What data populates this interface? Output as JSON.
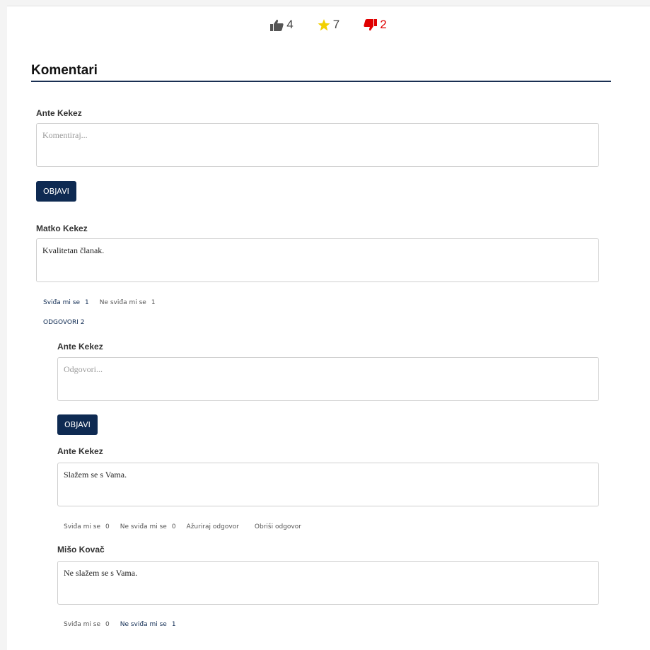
{
  "ratings": {
    "likes": "4",
    "stars": "7",
    "dislikes": "2",
    "colors": {
      "like": "#555555",
      "star": "#f2d000",
      "dislike": "#e00000"
    }
  },
  "section": {
    "title": "Komentari"
  },
  "new_comment": {
    "author": "Ante Kekez",
    "placeholder": "Komentiraj...",
    "submit_label": "OBJAVI"
  },
  "comments": [
    {
      "author": "Matko Kekez",
      "text": "Kvalitetan članak.",
      "like_label": "Sviđa mi se",
      "like_count": "1",
      "dislike_label": "Ne sviđa mi se",
      "dislike_count": "1",
      "replies_label": "ODGOVORI 2",
      "reply_form": {
        "author": "Ante Kekez",
        "placeholder": "Odgovori...",
        "submit_label": "OBJAVI"
      },
      "replies": [
        {
          "author": "Ante Kekez",
          "text": "Slažem se s Vama.",
          "like_label": "Sviđa mi se",
          "like_count": "0",
          "dislike_label": "Ne sviđa mi se",
          "dislike_count": "0",
          "edit_label": "Ažuriraj odgovor",
          "delete_label": "Obriši odgovor"
        },
        {
          "author": "Mišo Kovač",
          "text": "Ne slažem se s Vama.",
          "like_label": "Sviđa mi se",
          "like_count": "0",
          "dislike_label": "Ne sviđa mi se",
          "dislike_count": "1"
        }
      ]
    }
  ],
  "theme": {
    "primary": "#0e2a52"
  }
}
